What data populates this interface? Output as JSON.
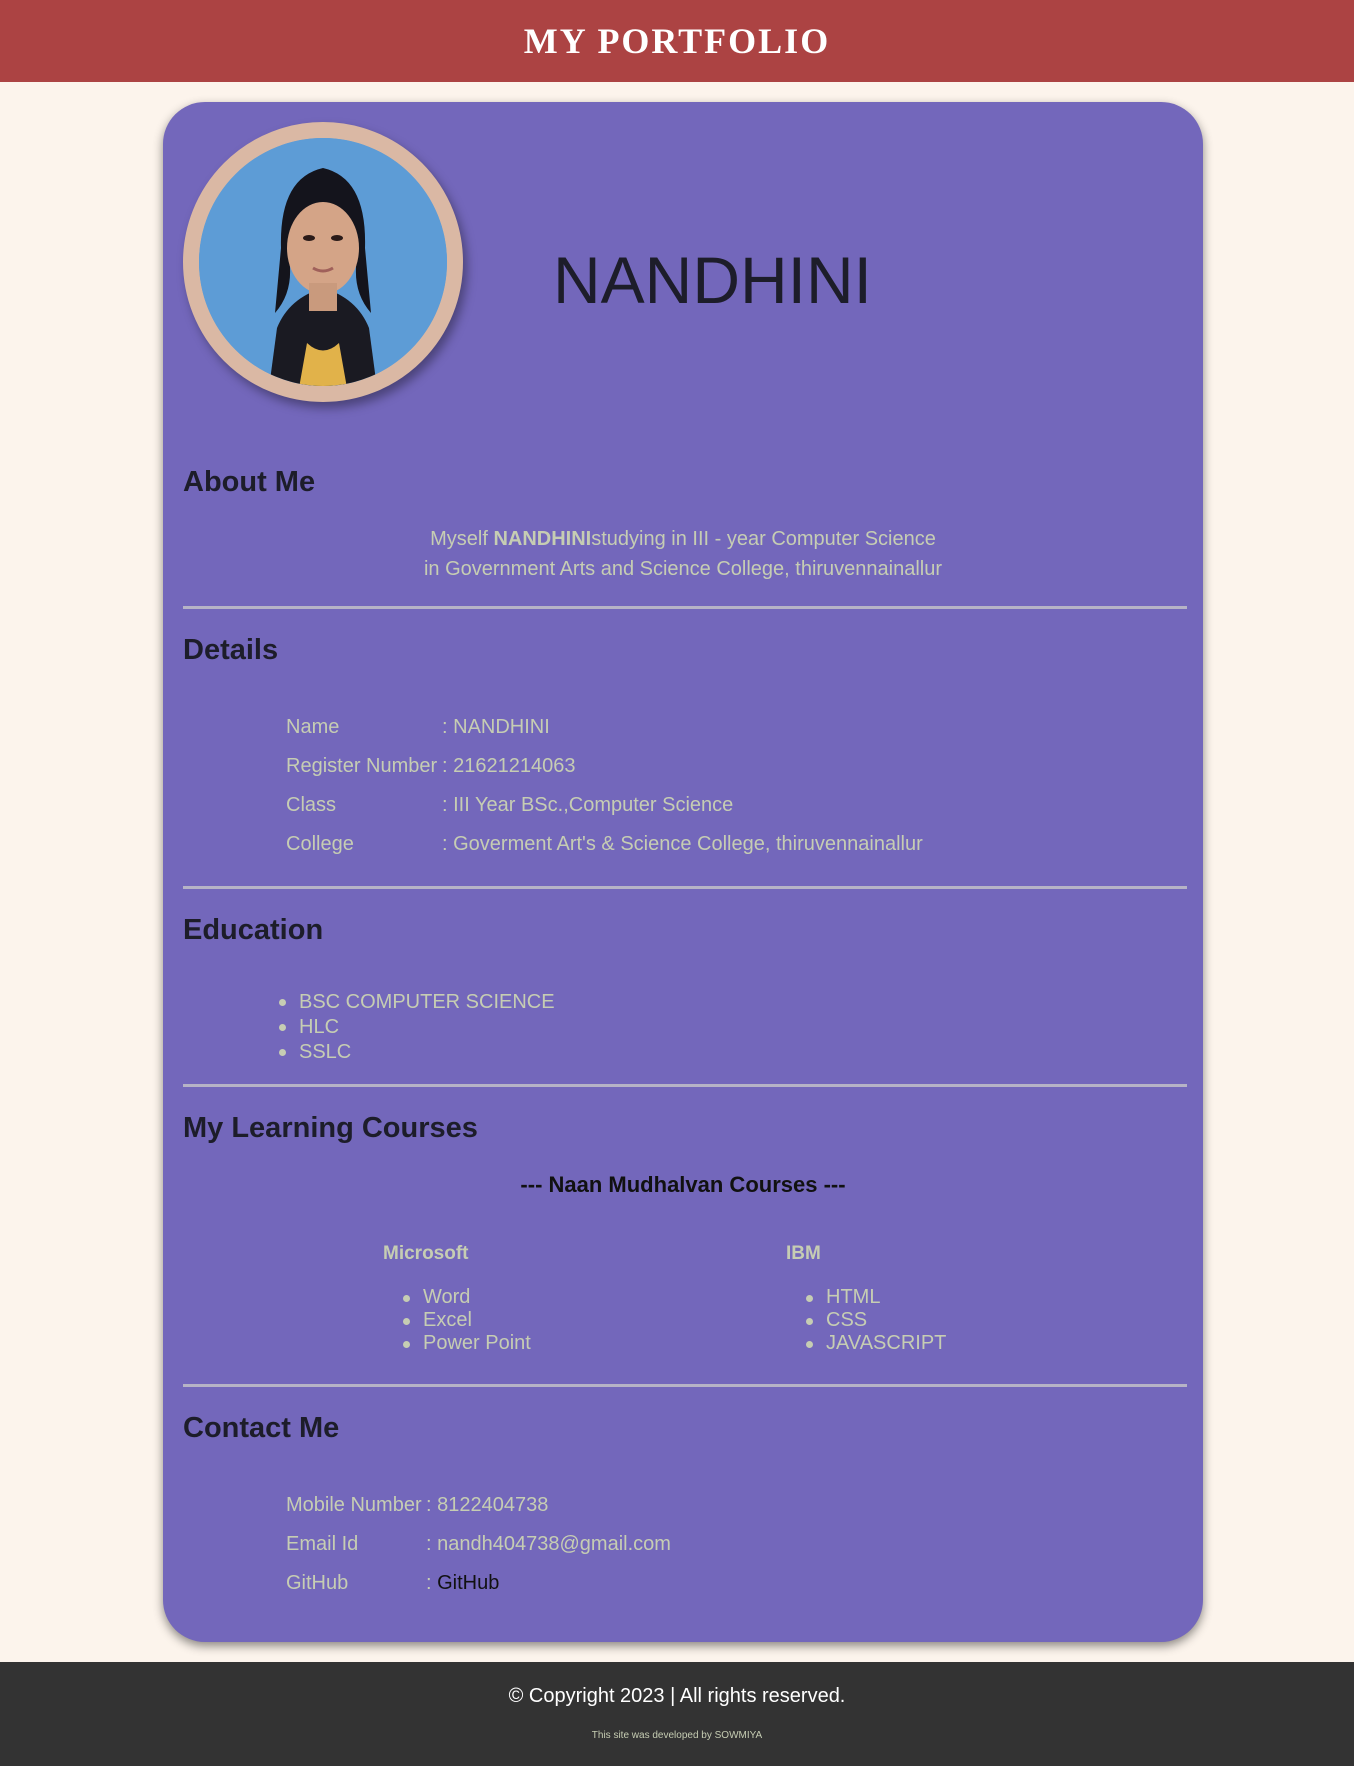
{
  "header": {
    "title": "MY PORTFOLIO"
  },
  "profile": {
    "name": "NANDHINI",
    "photo": "profile-photo"
  },
  "about": {
    "title": "About Me",
    "prefix": "Myself ",
    "name": "NANDHINI",
    "line1_rest": "studying in III - year Computer Science",
    "line2": "in Government Arts and Science College, thiruvennainallur"
  },
  "details": {
    "title": "Details",
    "rows": [
      {
        "label": "Name",
        "value": "NANDHINI"
      },
      {
        "label": "Register Number",
        "value": "21621214063"
      },
      {
        "label": "Class",
        "value": "III Year BSc.,Computer Science"
      },
      {
        "label": "College",
        "value": "Goverment Art's & Science College, thiruvennainallur"
      }
    ]
  },
  "education": {
    "title": "Education",
    "items": [
      "BSC COMPUTER SCIENCE",
      "HLC",
      "SSLC"
    ]
  },
  "courses": {
    "title": "My Learning Courses",
    "subtitle": "--- Naan Mudhalvan Courses ---",
    "groups": [
      {
        "name": "Microsoft",
        "items": [
          "Word",
          "Excel",
          "Power Point"
        ]
      },
      {
        "name": "IBM",
        "items": [
          "HTML",
          "CSS",
          "JAVASCRIPT"
        ]
      }
    ]
  },
  "contact": {
    "title": "Contact Me",
    "rows": [
      {
        "label": "Mobile Number",
        "value": "8122404738"
      },
      {
        "label": "Email Id",
        "value": "nandh404738@gmail.com"
      },
      {
        "label": "GitHub",
        "value": "GitHub"
      }
    ]
  },
  "separator": ":",
  "footer": {
    "copyright": "© Copyright 2023 | All rights reserved.",
    "developer": "This site was developed by SOWMIYA"
  },
  "colors": {
    "header_bg": "#ac4343",
    "card_bg": "#7367bb",
    "page_bg": "#fcf4ec",
    "text_muted": "#c6cdb3",
    "footer_bg": "#333333"
  }
}
